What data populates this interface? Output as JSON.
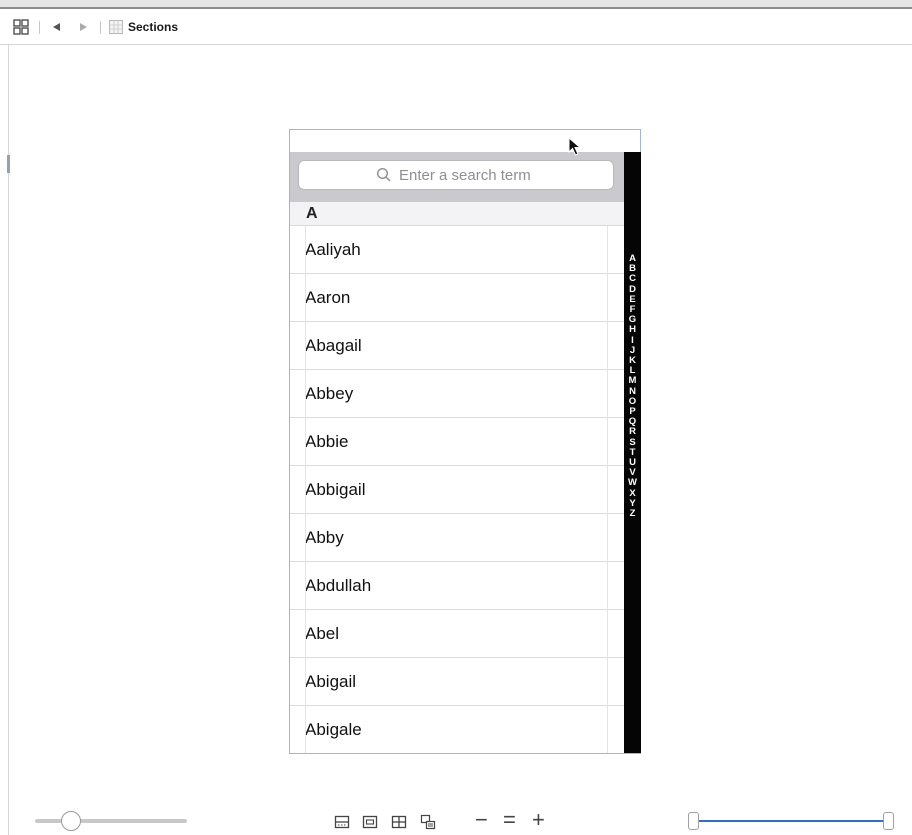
{
  "jumpbar": {
    "related_items_icon": "grid-icon",
    "back_icon": "back-arrow-icon",
    "forward_icon": "forward-arrow-icon",
    "file_icon": "storyboard-file-icon",
    "path_label": "Sections"
  },
  "table": {
    "search_placeholder": "Enter a search term",
    "section_header": "A",
    "rows": [
      "Aaliyah",
      "Aaron",
      "Abagail",
      "Abbey",
      "Abbie",
      "Abbigail",
      "Abby",
      "Abdullah",
      "Abel",
      "Abigail",
      "Abigale"
    ],
    "index": [
      "A",
      "B",
      "C",
      "D",
      "E",
      "F",
      "G",
      "H",
      "I",
      "J",
      "K",
      "L",
      "M",
      "N",
      "O",
      "P",
      "Q",
      "R",
      "S",
      "T",
      "U",
      "V",
      "W",
      "X",
      "Y",
      "Z"
    ]
  },
  "bottom_toolbar": {
    "zoom_out_label": "−",
    "zoom_actual_label": "=",
    "zoom_in_label": "+",
    "zoom_level": 0.2
  },
  "colors": {
    "index_bar": "#050505",
    "selection_blue": "#2d6fd6",
    "search_bar_bg": "#c9c9ce"
  }
}
